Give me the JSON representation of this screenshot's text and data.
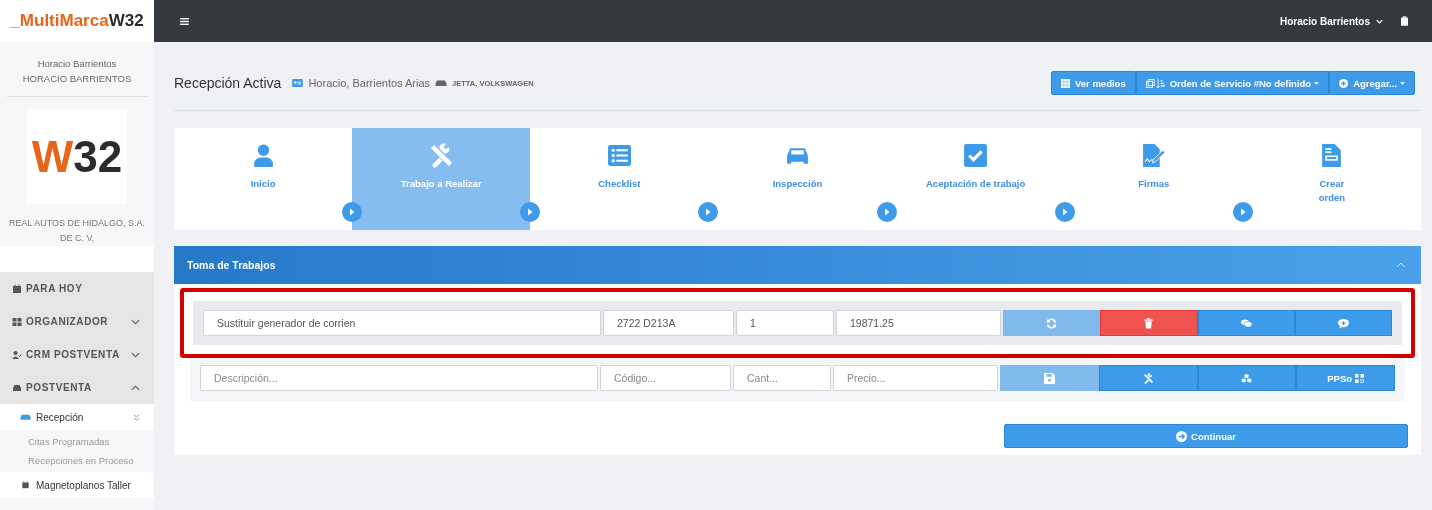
{
  "brand": {
    "accent": "_MultiMarca",
    "plain": "W32"
  },
  "topbar": {
    "user": "Horacio Barrientos"
  },
  "sidebar": {
    "user_name": "Horacio Barrientos",
    "user_upper": "HORACIO BARRIENTOS",
    "logo": {
      "accent": "W",
      "plain": "32"
    },
    "company": "REAL AUTOS DE HIDALGO, S.A. DE C. V.",
    "menu": [
      {
        "label": "PARA HOY",
        "kind": "link"
      },
      {
        "label": "ORGANIZADOR",
        "kind": "group",
        "expanded": false
      },
      {
        "label": "CRM POSTVENTA",
        "kind": "group",
        "expanded": false
      },
      {
        "label": "POSTVENTA",
        "kind": "group",
        "expanded": true,
        "children": [
          {
            "label": "Recepción",
            "children": [
              {
                "label": "Citas Programadas"
              },
              {
                "label": "Recepciones en Proceso"
              }
            ]
          },
          {
            "label": "Magnetoplanos Taller"
          }
        ]
      }
    ]
  },
  "header": {
    "title": "Recepción Activa",
    "customer": "Horacio, Barrientos Arias",
    "vehicle": "JETTA, VOLKSWAGEN",
    "actions": [
      {
        "label": "Ver medios",
        "dropdown": false
      },
      {
        "label": "Orden de Servicio #No definido",
        "dropdown": true
      },
      {
        "label": "Agregar...",
        "dropdown": true
      }
    ]
  },
  "steps": [
    {
      "label": "Inicio",
      "selected": false
    },
    {
      "label": "Trabajo a Realizar",
      "selected": true
    },
    {
      "label": "Checklist",
      "selected": false
    },
    {
      "label": "Inspección",
      "selected": false
    },
    {
      "label": "Aceptación de trabajo",
      "selected": false
    },
    {
      "label": "Firmas",
      "selected": false
    },
    {
      "label": "Crear orden",
      "selected": false
    }
  ],
  "panel": {
    "title": "Toma de Trabajos",
    "expanded": true,
    "item": {
      "description": "Sustituir generador de corrien",
      "code": "2722 D213A",
      "quantity": "1",
      "price": "19871.25",
      "highlighted": true
    },
    "new_row": {
      "description_placeholder": "Descripción...",
      "code_placeholder": "Código...",
      "quantity_placeholder": "Cant...",
      "price_placeholder": "Precio...",
      "ppso_label": "PPSo"
    },
    "continue": "Continuar"
  }
}
